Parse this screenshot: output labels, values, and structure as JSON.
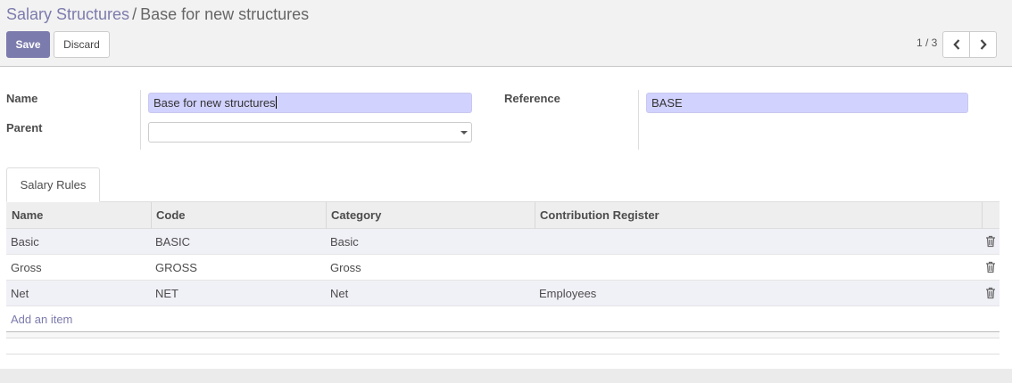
{
  "breadcrumb": {
    "parent": "Salary Structures",
    "separator": "/",
    "current": "Base for new structures"
  },
  "toolbar": {
    "save_label": "Save",
    "discard_label": "Discard"
  },
  "pager": {
    "value": "1 / 3"
  },
  "form": {
    "name_label": "Name",
    "name_value": "Base for new structures",
    "parent_label": "Parent",
    "parent_value": "",
    "reference_label": "Reference",
    "reference_value": "BASE"
  },
  "notebook": {
    "tab_label": "Salary Rules"
  },
  "table": {
    "columns": [
      "Name",
      "Code",
      "Category",
      "Contribution Register"
    ],
    "rows": [
      {
        "name": "Basic",
        "code": "BASIC",
        "category": "Basic",
        "register": ""
      },
      {
        "name": "Gross",
        "code": "GROSS",
        "category": "Gross",
        "register": ""
      },
      {
        "name": "Net",
        "code": "NET",
        "category": "Net",
        "register": "Employees"
      }
    ],
    "add_item_label": "Add an item"
  },
  "colors": {
    "accent": "#7c7bad",
    "required_field": "#d2d2ff"
  }
}
